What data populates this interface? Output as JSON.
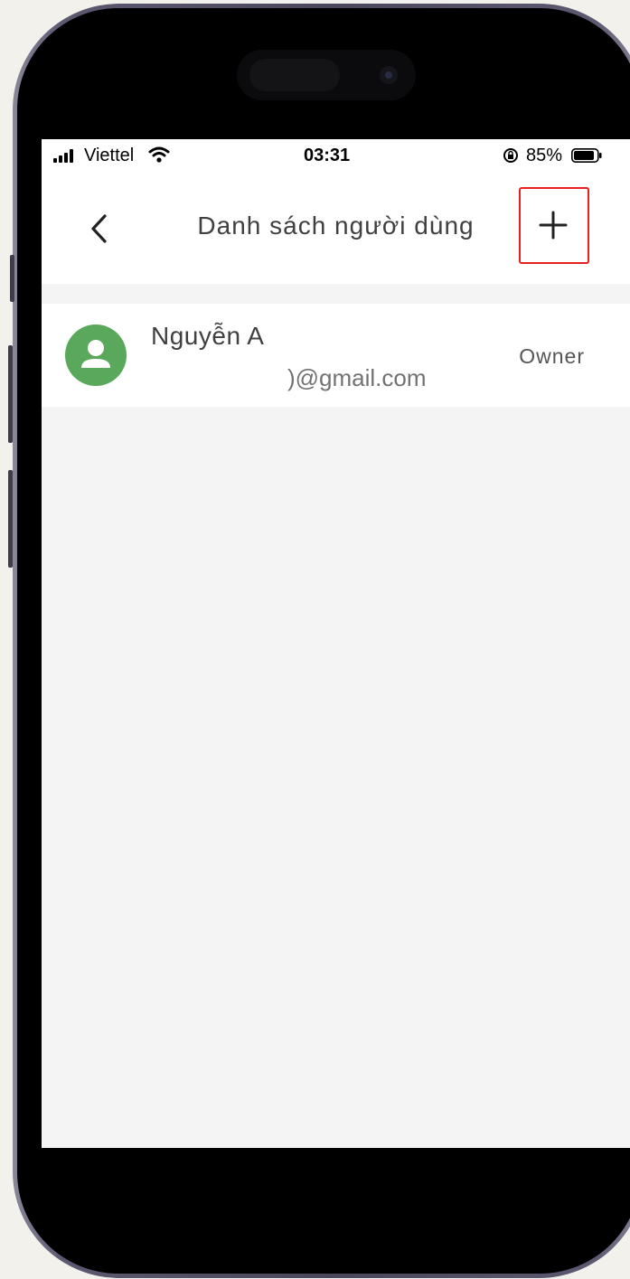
{
  "status_bar": {
    "carrier": "Viettel",
    "time": "03:31",
    "battery": "85%"
  },
  "header": {
    "title": "Danh sách người dùng",
    "back_icon": "chevron-left-icon",
    "add_icon": "plus-icon",
    "highlight_color": "#e8201f"
  },
  "users": [
    {
      "name": "Nguyễn A",
      "email": ")@gmail.com",
      "role": "Owner",
      "avatar_icon": "person-icon",
      "avatar_color": "#59a85b"
    }
  ]
}
